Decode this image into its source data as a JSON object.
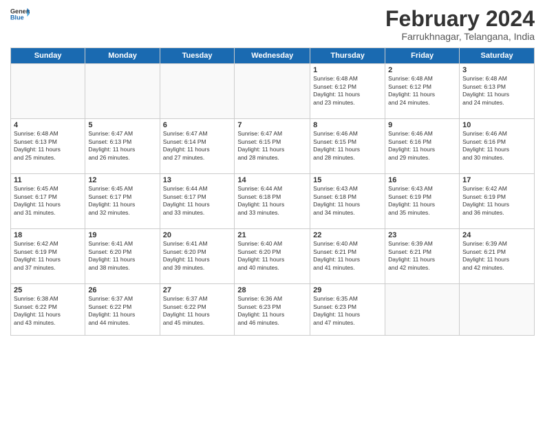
{
  "header": {
    "logo_general": "General",
    "logo_blue": "Blue",
    "main_title": "February 2024",
    "subtitle": "Farrukhnagar, Telangana, India"
  },
  "days_of_week": [
    "Sunday",
    "Monday",
    "Tuesday",
    "Wednesday",
    "Thursday",
    "Friday",
    "Saturday"
  ],
  "weeks": [
    [
      {
        "day": "",
        "info": ""
      },
      {
        "day": "",
        "info": ""
      },
      {
        "day": "",
        "info": ""
      },
      {
        "day": "",
        "info": ""
      },
      {
        "day": "1",
        "info": "Sunrise: 6:48 AM\nSunset: 6:12 PM\nDaylight: 11 hours\nand 23 minutes."
      },
      {
        "day": "2",
        "info": "Sunrise: 6:48 AM\nSunset: 6:12 PM\nDaylight: 11 hours\nand 24 minutes."
      },
      {
        "day": "3",
        "info": "Sunrise: 6:48 AM\nSunset: 6:13 PM\nDaylight: 11 hours\nand 24 minutes."
      }
    ],
    [
      {
        "day": "4",
        "info": "Sunrise: 6:48 AM\nSunset: 6:13 PM\nDaylight: 11 hours\nand 25 minutes."
      },
      {
        "day": "5",
        "info": "Sunrise: 6:47 AM\nSunset: 6:13 PM\nDaylight: 11 hours\nand 26 minutes."
      },
      {
        "day": "6",
        "info": "Sunrise: 6:47 AM\nSunset: 6:14 PM\nDaylight: 11 hours\nand 27 minutes."
      },
      {
        "day": "7",
        "info": "Sunrise: 6:47 AM\nSunset: 6:15 PM\nDaylight: 11 hours\nand 28 minutes."
      },
      {
        "day": "8",
        "info": "Sunrise: 6:46 AM\nSunset: 6:15 PM\nDaylight: 11 hours\nand 28 minutes."
      },
      {
        "day": "9",
        "info": "Sunrise: 6:46 AM\nSunset: 6:16 PM\nDaylight: 11 hours\nand 29 minutes."
      },
      {
        "day": "10",
        "info": "Sunrise: 6:46 AM\nSunset: 6:16 PM\nDaylight: 11 hours\nand 30 minutes."
      }
    ],
    [
      {
        "day": "11",
        "info": "Sunrise: 6:45 AM\nSunset: 6:17 PM\nDaylight: 11 hours\nand 31 minutes."
      },
      {
        "day": "12",
        "info": "Sunrise: 6:45 AM\nSunset: 6:17 PM\nDaylight: 11 hours\nand 32 minutes."
      },
      {
        "day": "13",
        "info": "Sunrise: 6:44 AM\nSunset: 6:17 PM\nDaylight: 11 hours\nand 33 minutes."
      },
      {
        "day": "14",
        "info": "Sunrise: 6:44 AM\nSunset: 6:18 PM\nDaylight: 11 hours\nand 33 minutes."
      },
      {
        "day": "15",
        "info": "Sunrise: 6:43 AM\nSunset: 6:18 PM\nDaylight: 11 hours\nand 34 minutes."
      },
      {
        "day": "16",
        "info": "Sunrise: 6:43 AM\nSunset: 6:19 PM\nDaylight: 11 hours\nand 35 minutes."
      },
      {
        "day": "17",
        "info": "Sunrise: 6:42 AM\nSunset: 6:19 PM\nDaylight: 11 hours\nand 36 minutes."
      }
    ],
    [
      {
        "day": "18",
        "info": "Sunrise: 6:42 AM\nSunset: 6:19 PM\nDaylight: 11 hours\nand 37 minutes."
      },
      {
        "day": "19",
        "info": "Sunrise: 6:41 AM\nSunset: 6:20 PM\nDaylight: 11 hours\nand 38 minutes."
      },
      {
        "day": "20",
        "info": "Sunrise: 6:41 AM\nSunset: 6:20 PM\nDaylight: 11 hours\nand 39 minutes."
      },
      {
        "day": "21",
        "info": "Sunrise: 6:40 AM\nSunset: 6:20 PM\nDaylight: 11 hours\nand 40 minutes."
      },
      {
        "day": "22",
        "info": "Sunrise: 6:40 AM\nSunset: 6:21 PM\nDaylight: 11 hours\nand 41 minutes."
      },
      {
        "day": "23",
        "info": "Sunrise: 6:39 AM\nSunset: 6:21 PM\nDaylight: 11 hours\nand 42 minutes."
      },
      {
        "day": "24",
        "info": "Sunrise: 6:39 AM\nSunset: 6:21 PM\nDaylight: 11 hours\nand 42 minutes."
      }
    ],
    [
      {
        "day": "25",
        "info": "Sunrise: 6:38 AM\nSunset: 6:22 PM\nDaylight: 11 hours\nand 43 minutes."
      },
      {
        "day": "26",
        "info": "Sunrise: 6:37 AM\nSunset: 6:22 PM\nDaylight: 11 hours\nand 44 minutes."
      },
      {
        "day": "27",
        "info": "Sunrise: 6:37 AM\nSunset: 6:22 PM\nDaylight: 11 hours\nand 45 minutes."
      },
      {
        "day": "28",
        "info": "Sunrise: 6:36 AM\nSunset: 6:23 PM\nDaylight: 11 hours\nand 46 minutes."
      },
      {
        "day": "29",
        "info": "Sunrise: 6:35 AM\nSunset: 6:23 PM\nDaylight: 11 hours\nand 47 minutes."
      },
      {
        "day": "",
        "info": ""
      },
      {
        "day": "",
        "info": ""
      }
    ]
  ]
}
